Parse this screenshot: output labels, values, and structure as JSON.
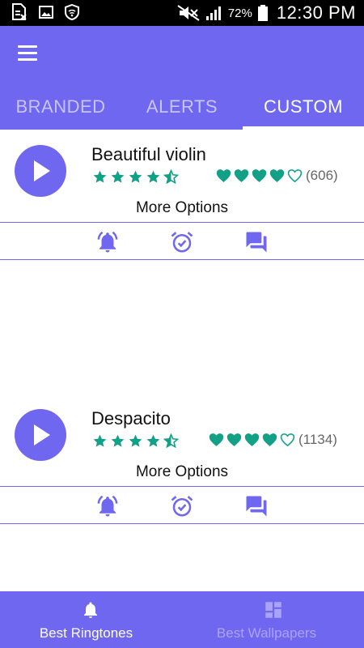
{
  "status_bar": {
    "battery_percent": "72%",
    "time": "12:30 PM"
  },
  "tabs": [
    {
      "label": "BRANDED",
      "active": false
    },
    {
      "label": "ALERTS",
      "active": false
    },
    {
      "label": "CUSTOM",
      "active": true
    }
  ],
  "ringtones": [
    {
      "title": "Beautiful violin",
      "star_rating": 4.5,
      "hearts_filled": 4,
      "hearts_total": 5,
      "count": "(606)",
      "more_label": "More Options"
    },
    {
      "title": "Despacito",
      "star_rating": 4.5,
      "hearts_filled": 4,
      "hearts_total": 5,
      "count": "(1134)",
      "more_label": "More Options"
    }
  ],
  "bottom_nav": [
    {
      "label": "Best Ringtones",
      "icon": "bell-icon",
      "active": true
    },
    {
      "label": "Best Wallpapers",
      "icon": "dashboard-icon",
      "active": false
    }
  ],
  "colors": {
    "primary": "#6f67f0",
    "rating": "#12a086"
  }
}
